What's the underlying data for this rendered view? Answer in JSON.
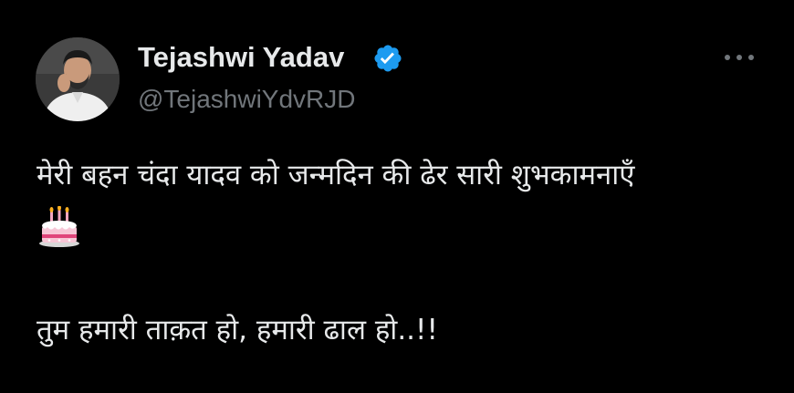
{
  "author": {
    "display_name": "Tejashwi Yadav",
    "handle": "@TejashwiYdvRJD",
    "verified": true,
    "verified_icon": "verified-badge-icon",
    "avatar_icon": "profile-avatar"
  },
  "menu": {
    "more_icon": "more-horizontal-icon"
  },
  "tweet": {
    "line1": "मेरी बहन चंदा यादव को जन्मदिन की ढेर सारी शुभकामनाएँ",
    "emoji": "birthday-cake-emoji",
    "line2": "तुम हमारी ताक़त हो, हमारी ढाल हो..!!"
  },
  "colors": {
    "background": "#000000",
    "primary_text": "#e7e9ea",
    "secondary_text": "#71767b",
    "verified_blue": "#1d9bf0"
  }
}
